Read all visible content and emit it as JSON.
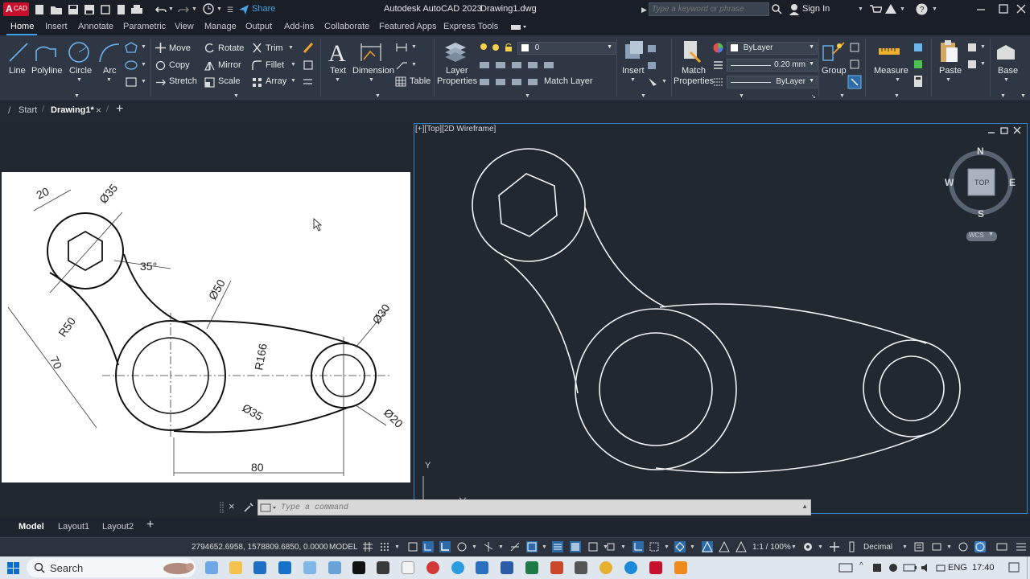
{
  "app": {
    "title": "Autodesk AutoCAD 2023",
    "filename": "Drawing1.dwg",
    "logo_text": "CAD",
    "share_label": "Share",
    "search_placeholder": "Type a keyword or phrase",
    "signin_label": "Sign In"
  },
  "ribbon_tabs": [
    "Home",
    "Insert",
    "Annotate",
    "Parametric",
    "View",
    "Manage",
    "Output",
    "Add-ins",
    "Collaborate",
    "Featured Apps",
    "Express Tools"
  ],
  "ribbon": {
    "draw": {
      "line": "Line",
      "polyline": "Polyline",
      "circle": "Circle",
      "arc": "Arc"
    },
    "modify": {
      "move": "Move",
      "rotate": "Rotate",
      "trim": "Trim",
      "copy": "Copy",
      "mirror": "Mirror",
      "fillet": "Fillet",
      "stretch": "Stretch",
      "scale": "Scale",
      "array": "Array"
    },
    "annotation": {
      "text": "Text",
      "dimension": "Dimension",
      "table": "Table"
    },
    "layers": {
      "layer_properties_1": "Layer",
      "layer_properties_2": "Properties",
      "current_layer": "0",
      "match_layer": "Match Layer"
    },
    "block": {
      "insert": "Insert"
    },
    "properties": {
      "match_1": "Match",
      "match_2": "Properties",
      "color": "ByLayer",
      "lineweight": "0.20 mm",
      "linetype": "ByLayer"
    },
    "groups": {
      "group": "Group"
    },
    "utilities": {
      "measure": "Measure"
    },
    "clipboard": {
      "paste": "Paste"
    },
    "view": {
      "base": "Base"
    }
  },
  "doc_tabs": {
    "start": "Start",
    "drawing": "Drawing1*"
  },
  "viewport": {
    "label": "[+][Top][2D Wireframe]",
    "viewcube": {
      "top": "TOP",
      "n": "N",
      "s": "S",
      "e": "E",
      "w": "W",
      "wcs": "WCS"
    },
    "ucs_y": "Y"
  },
  "reference_drawing": {
    "dims": [
      "20",
      "Ø35",
      "35°",
      "Ø50",
      "R50",
      "70",
      "R166",
      "Ø30",
      "Ø35",
      "Ø20",
      "80"
    ]
  },
  "command": {
    "placeholder": "Type a command"
  },
  "layout_tabs": [
    "Model",
    "Layout1",
    "Layout2"
  ],
  "status": {
    "coords": "2794652.6958, 1578809.6850, 0.0000",
    "mode": "MODEL",
    "scale": "1:1 / 100%",
    "units": "Decimal"
  },
  "taskbar": {
    "search": "Search",
    "lang": "ENG",
    "time": "17:40"
  }
}
